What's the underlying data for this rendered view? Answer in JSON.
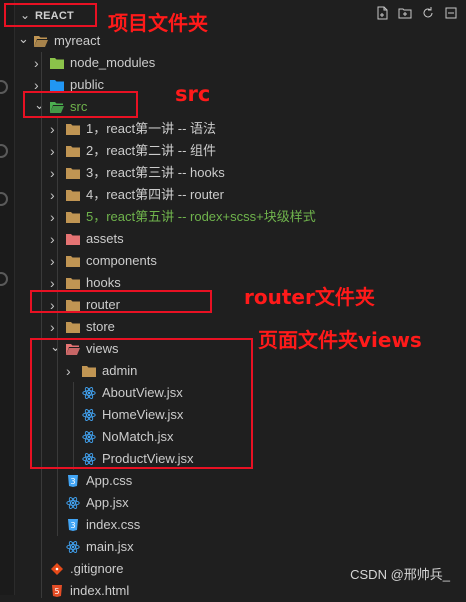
{
  "explorer": {
    "title": "REACT",
    "actions": [
      "new-file-icon",
      "new-folder-icon",
      "refresh-icon",
      "collapse-all-icon"
    ]
  },
  "tree": [
    {
      "label": "myreact",
      "type": "folder",
      "open": true,
      "depth": 1,
      "icon": "folder-icon"
    },
    {
      "label": "node_modules",
      "type": "folder",
      "open": false,
      "depth": 2,
      "icon": "node-modules-folder-icon"
    },
    {
      "label": "public",
      "type": "folder",
      "open": false,
      "depth": 2,
      "icon": "public-folder-icon"
    },
    {
      "label": "src",
      "type": "folder",
      "open": true,
      "depth": 2,
      "icon": "src-folder-icon",
      "color": "#6fb34c"
    },
    {
      "label": "1，react第一讲 -- 语法",
      "type": "folder",
      "open": false,
      "depth": 3,
      "icon": "folder-icon"
    },
    {
      "label": "2，react第二讲 -- 组件",
      "type": "folder",
      "open": false,
      "depth": 3,
      "icon": "folder-icon"
    },
    {
      "label": "3，react第三讲 -- hooks",
      "type": "folder",
      "open": false,
      "depth": 3,
      "icon": "folder-icon"
    },
    {
      "label": "4，react第四讲 -- router",
      "type": "folder",
      "open": false,
      "depth": 3,
      "icon": "folder-icon"
    },
    {
      "label": "5，react第五讲 -- rodex+scss+块级样式",
      "type": "folder",
      "open": false,
      "depth": 3,
      "icon": "folder-icon",
      "color": "#6fb34c"
    },
    {
      "label": "assets",
      "type": "folder",
      "open": false,
      "depth": 3,
      "icon": "assets-folder-icon"
    },
    {
      "label": "components",
      "type": "folder",
      "open": false,
      "depth": 3,
      "icon": "components-folder-icon"
    },
    {
      "label": "hooks",
      "type": "folder",
      "open": false,
      "depth": 3,
      "icon": "hooks-folder-icon"
    },
    {
      "label": "router",
      "type": "folder",
      "open": false,
      "depth": 3,
      "icon": "router-folder-icon"
    },
    {
      "label": "store",
      "type": "folder",
      "open": false,
      "depth": 3,
      "icon": "store-folder-icon"
    },
    {
      "label": "views",
      "type": "folder",
      "open": true,
      "depth": 3,
      "icon": "views-folder-icon"
    },
    {
      "label": "admin",
      "type": "folder",
      "open": false,
      "depth": 4,
      "icon": "folder-icon"
    },
    {
      "label": "AboutView.jsx",
      "type": "file",
      "depth": 4,
      "icon": "react-icon"
    },
    {
      "label": "HomeView.jsx",
      "type": "file",
      "depth": 4,
      "icon": "react-icon"
    },
    {
      "label": "NoMatch.jsx",
      "type": "file",
      "depth": 4,
      "icon": "react-icon"
    },
    {
      "label": "ProductView.jsx",
      "type": "file",
      "depth": 4,
      "icon": "react-icon"
    },
    {
      "label": "App.css",
      "type": "file",
      "depth": 3,
      "icon": "css-icon"
    },
    {
      "label": "App.jsx",
      "type": "file",
      "depth": 3,
      "icon": "react-icon"
    },
    {
      "label": "index.css",
      "type": "file",
      "depth": 3,
      "icon": "css-icon"
    },
    {
      "label": "main.jsx",
      "type": "file",
      "depth": 3,
      "icon": "react-icon"
    },
    {
      "label": ".gitignore",
      "type": "file",
      "depth": 2,
      "icon": "git-icon"
    },
    {
      "label": "index.html",
      "type": "file",
      "depth": 2,
      "icon": "html-icon"
    }
  ],
  "annotations": {
    "project_folder": "项目文件夹",
    "src": "src",
    "router_folder": "router文件夹",
    "views_folder": "页面文件夹views"
  },
  "annotation_color": "#ff1a1a",
  "watermark": "CSDN @邢帅兵_"
}
